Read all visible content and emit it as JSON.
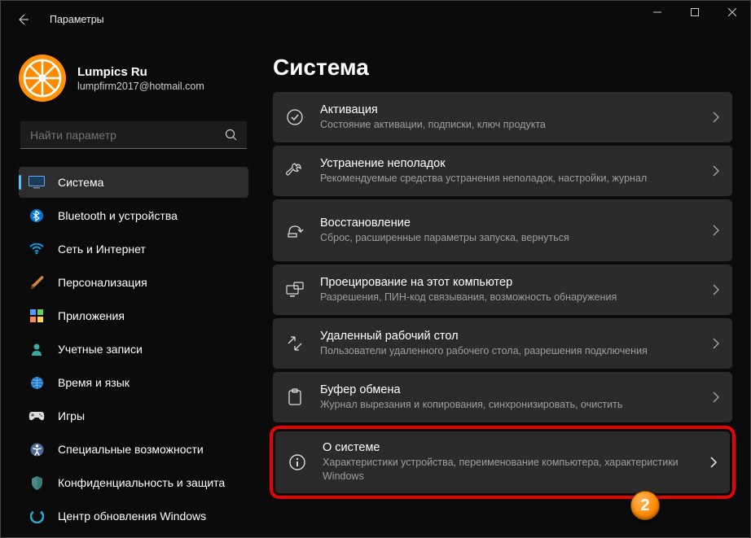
{
  "window": {
    "title": "Параметры"
  },
  "profile": {
    "name": "Lumpics Ru",
    "email": "lumpfirm2017@hotmail.com"
  },
  "search": {
    "placeholder": "Найти параметр"
  },
  "nav": [
    {
      "label": "Система",
      "active": true
    },
    {
      "label": "Bluetooth и устройства"
    },
    {
      "label": "Сеть и Интернет"
    },
    {
      "label": "Персонализация"
    },
    {
      "label": "Приложения"
    },
    {
      "label": "Учетные записи"
    },
    {
      "label": "Время и язык"
    },
    {
      "label": "Игры"
    },
    {
      "label": "Специальные возможности"
    },
    {
      "label": "Конфиденциальность и защита"
    },
    {
      "label": "Центр обновления Windows"
    }
  ],
  "page": {
    "title": "Система",
    "cards": [
      {
        "title": "Активация",
        "sub": "Состояние активации, подписки, ключ продукта"
      },
      {
        "title": "Устранение неполадок",
        "sub": "Рекомендуемые средства устранения неполадок, настройки, журнал"
      },
      {
        "title": "Восстановление",
        "sub": "Сброс, расширенные параметры запуска, вернуться"
      },
      {
        "title": "Проецирование на этот компьютер",
        "sub": "Разрешения, ПИН-код связывания, возможность обнаружения"
      },
      {
        "title": "Удаленный рабочий стол",
        "sub": "Пользователи удаленного рабочего стола, разрешения подключения"
      },
      {
        "title": "Буфер обмена",
        "sub": "Журнал вырезания и копирования, синхронизировать, очистить"
      },
      {
        "title": "О системе",
        "sub": "Характеристики устройства, переименование компьютера, характеристики Windows",
        "highlighted": true
      }
    ]
  },
  "annotation": {
    "step": "2"
  }
}
